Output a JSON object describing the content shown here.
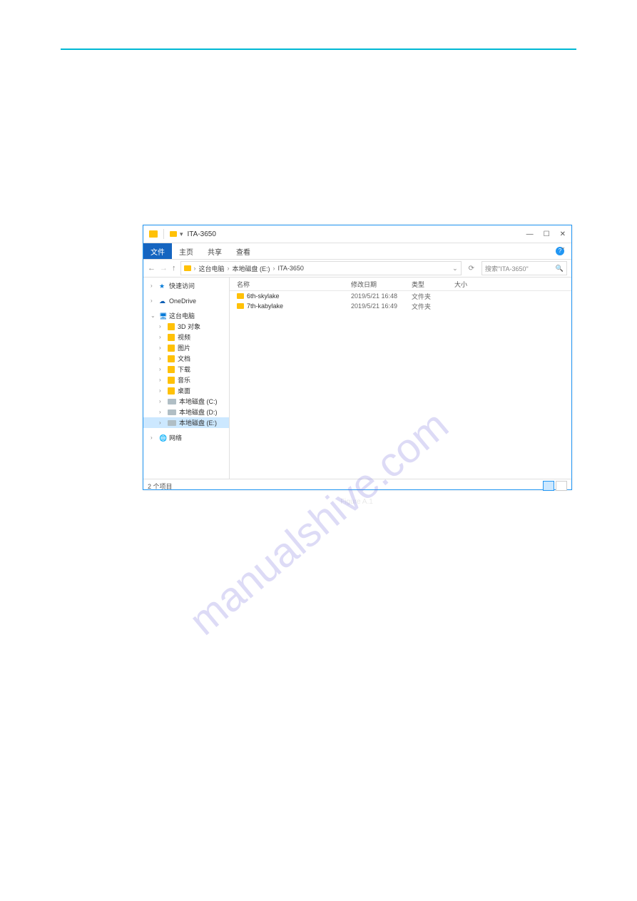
{
  "window": {
    "title": "ITA-3650",
    "controls": {
      "min": "—",
      "max": "☐",
      "close": "✕"
    }
  },
  "ribbon": {
    "tabs": [
      "文件",
      "主页",
      "共享",
      "查看"
    ]
  },
  "breadcrumb": {
    "items": [
      "这台电脑",
      "本地磁盘 (E:)",
      "ITA-3650"
    ]
  },
  "search": {
    "placeholder": "搜索\"ITA-3650\""
  },
  "tree": {
    "quick": "快速访问",
    "onedrive": "OneDrive",
    "thispc": "这台电脑",
    "children": [
      {
        "label": "3D 对象"
      },
      {
        "label": "视频"
      },
      {
        "label": "图片"
      },
      {
        "label": "文档"
      },
      {
        "label": "下载"
      },
      {
        "label": "音乐"
      },
      {
        "label": "桌面"
      },
      {
        "label": "本地磁盘 (C:)"
      },
      {
        "label": "本地磁盘 (D:)"
      },
      {
        "label": "本地磁盘 (E:)"
      }
    ],
    "network": "网络"
  },
  "columns": {
    "name": "名称",
    "date": "修改日期",
    "type": "类型",
    "size": "大小"
  },
  "rows": [
    {
      "name": "6th-skylake",
      "date": "2019/5/21 16:48",
      "type": "文件夹",
      "size": ""
    },
    {
      "name": "7th-kabylake",
      "date": "2019/5/21 16:49",
      "type": "文件夹",
      "size": ""
    }
  ],
  "status": "2 个项目",
  "watermark": "manualshive.com",
  "caption": "Figure A.1"
}
